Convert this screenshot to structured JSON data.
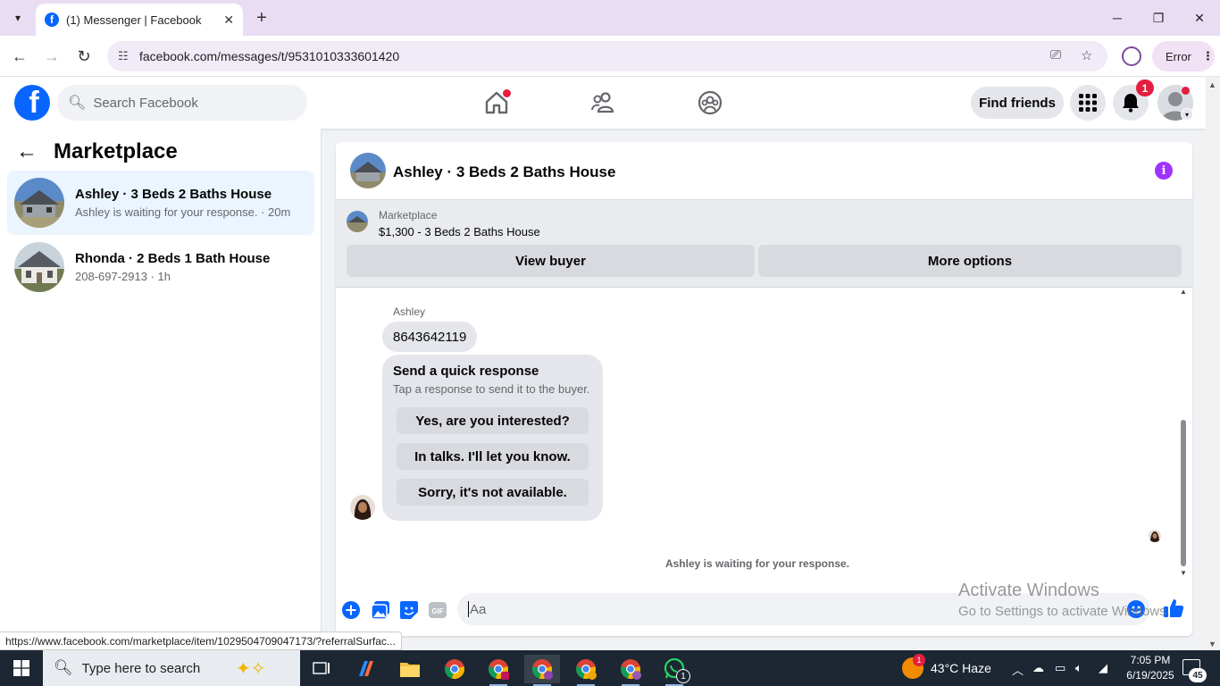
{
  "browser": {
    "tab_title": "(1) Messenger | Facebook",
    "url": "facebook.com/messages/t/9531010333601420",
    "profile_button_label": "Error",
    "status_url": "https://www.facebook.com/marketplace/item/1029504709047173/?referralSurfac..."
  },
  "facebook": {
    "logo_letter": "f",
    "search_placeholder": "Search Facebook",
    "find_friends_label": "Find friends",
    "notification_count": "1"
  },
  "sidebar": {
    "title": "Marketplace",
    "conversations": [
      {
        "title": "Ashley · 3 Beds 2 Baths House",
        "subtitle": "Ashley is waiting for your response. · 20m",
        "active": true
      },
      {
        "title": "Rhonda · 2 Beds 1 Bath House",
        "subtitle": "208-697-2913 · 1h",
        "active": false
      }
    ]
  },
  "chat": {
    "title": "Ashley · 3 Beds 2 Baths House",
    "listing": {
      "label": "Marketplace",
      "price_title": "$1,300 - 3 Beds 2 Baths House",
      "view_buyer_label": "View buyer",
      "more_options_label": "More options"
    },
    "sender_name": "Ashley",
    "message_text": "8643642119",
    "quick_response": {
      "title": "Send a quick response",
      "subtitle": "Tap a response to send it to the buyer.",
      "options": [
        "Yes, are you interested?",
        "In talks. I'll let you know.",
        "Sorry, it's not available."
      ]
    },
    "waiting_text": "Ashley is waiting for your response.",
    "composer_placeholder": "Aa"
  },
  "watermark": {
    "line1": "Activate Windows",
    "line2": "Go to Settings to activate Windows."
  },
  "taskbar": {
    "search_placeholder": "Type here to search",
    "weather_text": "43°C  Haze",
    "weather_badge": "1",
    "time": "7:05 PM",
    "date": "6/19/2025",
    "notification_count": "45",
    "whatsapp_badge": "1"
  },
  "colors": {
    "facebook_blue": "#0866ff",
    "notification_red": "#e41e3f",
    "info_purple": "#a033ff",
    "active_conversation_bg": "#ebf5ff"
  }
}
